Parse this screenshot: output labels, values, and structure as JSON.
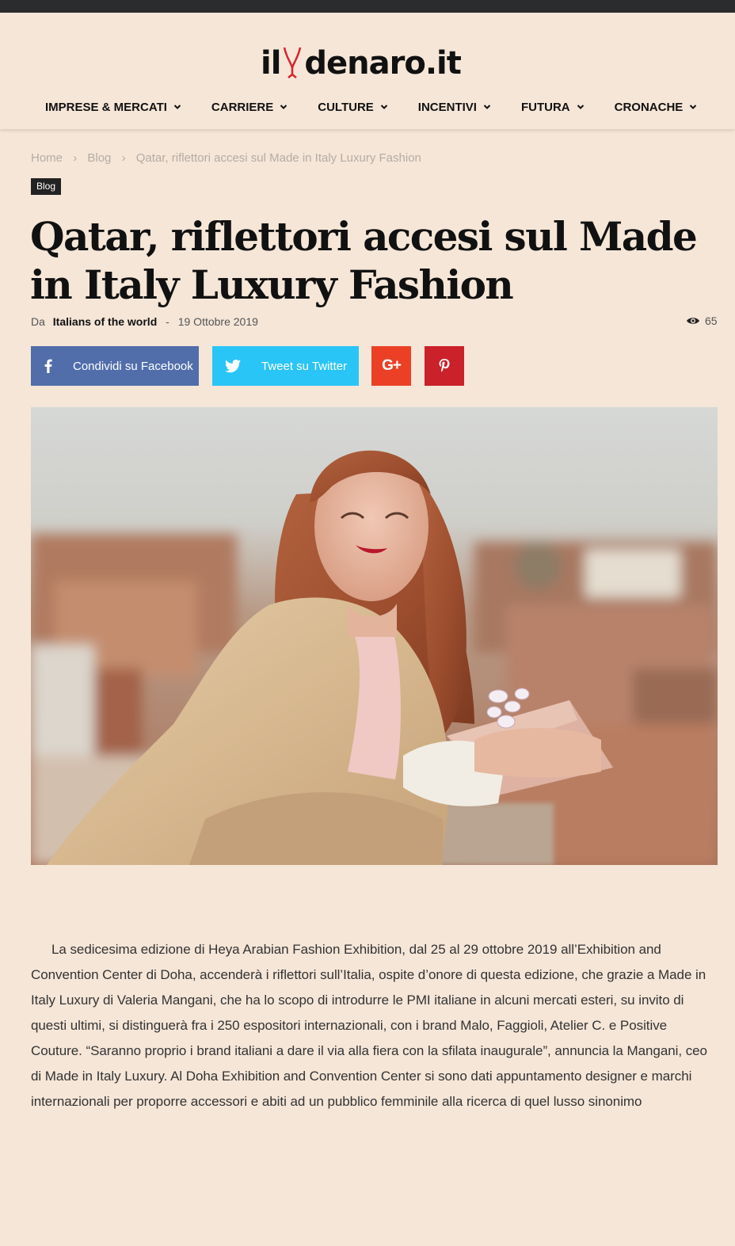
{
  "site": {
    "logo_left": "il",
    "logo_right": "denaro.it"
  },
  "nav": [
    {
      "label": "IMPRESE & MERCATI"
    },
    {
      "label": "CARRIERE"
    },
    {
      "label": "CULTURE"
    },
    {
      "label": "INCENTIVI"
    },
    {
      "label": "FUTURA"
    },
    {
      "label": "CRONACHE"
    }
  ],
  "breadcrumb": {
    "home": "Home",
    "section": "Blog",
    "current": "Qatar, riflettori accesi sul Made in Italy Luxury Fashion",
    "separator": "›"
  },
  "category": "Blog",
  "article": {
    "title": "Qatar, riflettori accesi sul Made in Italy Luxury Fashion",
    "by_label": "Da",
    "author": "Italians of the world",
    "dash": "-",
    "date": "19 Ottobre 2019",
    "views": "65",
    "body": "La sedicesima edizione di Heya Arabian Fashion Exhibition, dal 25 al 29 ottobre 2019 all’Exhibition and Convention Center di Doha, accenderà i riflettori sull’Italia, ospite d’onore di questa edizione, che grazie a Made in Italy Luxury di Valeria Mangani, che ha lo scopo di introdurre le PMI italiane in alcuni mercati esteri, su invito di questi ultimi, si distinguerà fra i 250 espositori internazionali, con i brand Malo, Faggioli, Atelier C. e Positive Couture. “Saranno proprio i brand italiani a dare il via alla fiera con la sfilata inaugurale”, annuncia la Mangani, ceo di Made in Italy Luxury. Al Doha Exhibition and Convention Center si sono dati appuntamento designer e marchi internazionali per proporre accessori e abiti ad un pubblico femminile alla ricerca di quel lusso sinonimo"
  },
  "share": {
    "facebook_label": "Condividi su Facebook",
    "twitter_label": "Tweet su Twitter",
    "googleplus_label": "G+"
  },
  "icons": {
    "facebook": "facebook-icon",
    "twitter": "twitter-icon",
    "googleplus": "google-plus-icon",
    "pinterest": "pinterest-icon",
    "views": "eye-icon",
    "nav_dropdown": "chevron-down-icon"
  },
  "colors": {
    "background": "#f5e6d8",
    "topbar": "#2b2c2e",
    "facebook": "#516eab",
    "twitter": "#29c5f6",
    "googleplus": "#eb4026",
    "pinterest": "#ca212a",
    "logo_accent": "#d9232d"
  }
}
